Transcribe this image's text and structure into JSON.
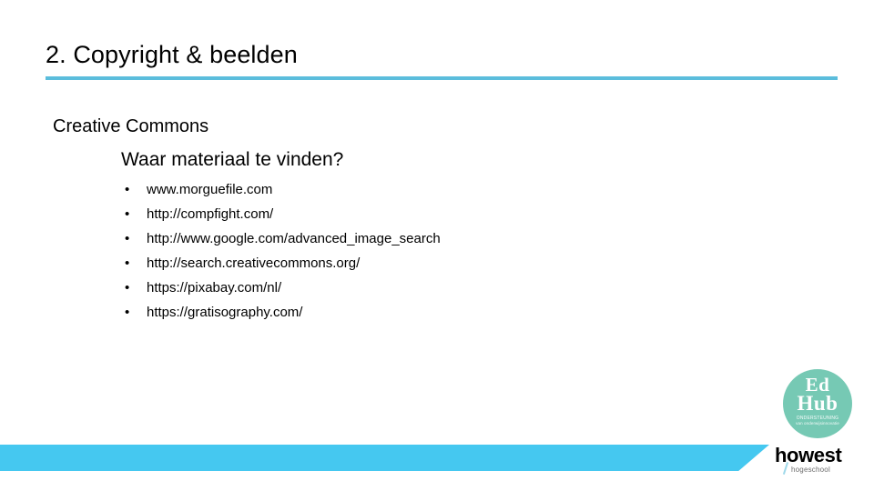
{
  "slide": {
    "title": "2. Copyright & beelden",
    "heading_level1": "Creative Commons",
    "heading_level2": "Waar materiaal te vinden?",
    "bullet_char": "•",
    "links": [
      "www.morguefile.com",
      "http://compfight.com/",
      "http://www.google.com/advanced_image_search",
      "http://search.creativecommons.org/",
      "https://pixabay.com/nl/",
      "https://gratisography.com/"
    ]
  },
  "branding": {
    "edhub": {
      "line1": "Ed",
      "line2": "Hub",
      "tagline1": "ONDERSTEUNING",
      "tagline2": "van onderwijsinnovatie"
    },
    "howest": {
      "name": "howest",
      "subtitle": "hogeschool"
    }
  },
  "colors": {
    "title_rule": "#5BBDDC",
    "footer_bar": "#45C8F0",
    "edhub_circle": "#76C9B4",
    "text": "#000000"
  }
}
